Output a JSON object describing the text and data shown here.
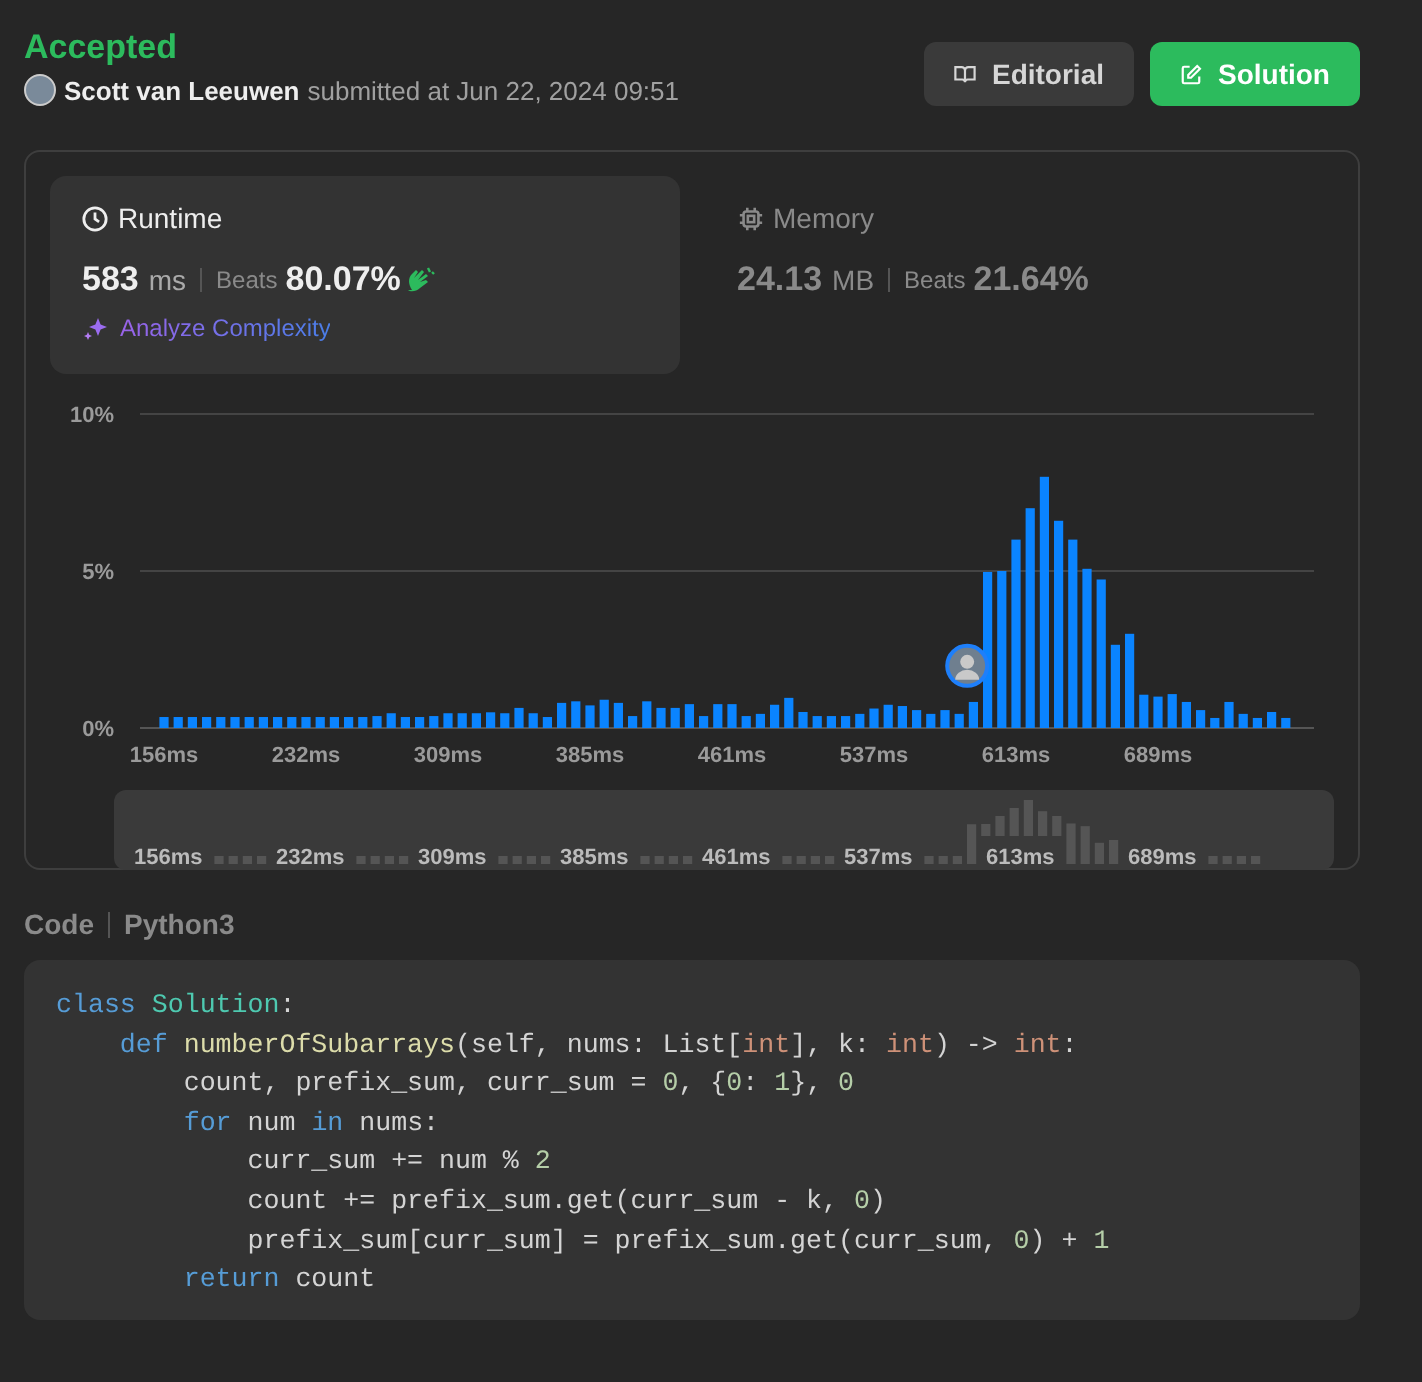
{
  "status": {
    "verdict": "Accepted",
    "author": "Scott van Leeuwen",
    "submitted": "submitted at Jun 22, 2024 09:51"
  },
  "buttons": [
    {
      "label": "Editorial",
      "kind": "secondary"
    },
    {
      "label": "Solution",
      "kind": "primary"
    }
  ],
  "stats": [
    {
      "kind": "runtime",
      "title": "Runtime",
      "value": "583",
      "unit": "ms",
      "beats_label": "Beats",
      "beats": "80.07%",
      "selected": true,
      "action": "Analyze Complexity"
    },
    {
      "kind": "memory",
      "title": "Memory",
      "value": "24.13",
      "unit": "MB",
      "beats_label": "Beats",
      "beats": "21.64%",
      "selected": false
    }
  ],
  "chart": {
    "chart_data": {
      "type": "bar",
      "ylim": [
        0,
        10
      ],
      "yticks": [
        {
          "value": 0,
          "label": "0%"
        },
        {
          "value": 5,
          "label": "5%"
        },
        {
          "value": 10,
          "label": "10%"
        }
      ],
      "categories": [
        "156ms",
        null,
        null,
        null,
        null,
        null,
        null,
        null,
        null,
        null,
        "232ms",
        null,
        null,
        null,
        null,
        null,
        null,
        null,
        null,
        null,
        "309ms",
        null,
        null,
        null,
        null,
        null,
        null,
        null,
        null,
        null,
        "385ms",
        null,
        null,
        null,
        null,
        null,
        null,
        null,
        null,
        null,
        "461ms",
        null,
        null,
        null,
        null,
        null,
        null,
        null,
        null,
        null,
        "537ms",
        null,
        null,
        null,
        null,
        null,
        null,
        null,
        null,
        null,
        "613ms",
        null,
        null,
        null,
        null,
        null,
        null,
        null,
        null,
        null,
        "689ms",
        null,
        null,
        null,
        null,
        null,
        null,
        null,
        null,
        null
      ],
      "values": [
        0.35,
        0.35,
        0.35,
        0.35,
        0.35,
        0.35,
        0.35,
        0.35,
        0.35,
        0.35,
        0.35,
        0.35,
        0.35,
        0.35,
        0.35,
        0.38,
        0.47,
        0.35,
        0.35,
        0.38,
        0.47,
        0.47,
        0.47,
        0.5,
        0.47,
        0.64,
        0.47,
        0.35,
        0.8,
        0.85,
        0.72,
        0.9,
        0.8,
        0.38,
        0.85,
        0.64,
        0.64,
        0.76,
        0.38,
        0.76,
        0.76,
        0.38,
        0.45,
        0.74,
        0.96,
        0.51,
        0.38,
        0.38,
        0.38,
        0.45,
        0.62,
        0.74,
        0.7,
        0.57,
        0.45,
        0.57,
        0.45,
        0.83,
        4.97,
        5.0,
        6.0,
        7.0,
        8.0,
        6.6,
        6.0,
        5.07,
        4.73,
        2.65,
        3.0,
        1.06,
        1.0,
        1.08,
        0.83,
        0.57,
        0.32,
        0.83,
        0.45,
        0.32,
        0.51,
        0.32
      ]
    }
  },
  "overview": {
    "labels": [
      "156ms",
      "232ms",
      "309ms",
      "385ms",
      "461ms",
      "537ms",
      "613ms",
      "689ms"
    ]
  },
  "code": {
    "label": "Code",
    "language": "Python3",
    "lines": [
      [
        {
          "text": "class ",
          "kind": "kw"
        },
        {
          "text": "Solution",
          "kind": "cls"
        },
        {
          "text": ":",
          "kind": "p"
        }
      ],
      [
        {
          "text": "    def ",
          "kind": "kw"
        },
        {
          "text": "numberOfSubarrays",
          "kind": "fn"
        },
        {
          "text": "(self, nums: List[",
          "kind": "p"
        },
        {
          "text": "int",
          "kind": "ty"
        },
        {
          "text": "], k: ",
          "kind": "p"
        },
        {
          "text": "int",
          "kind": "ty"
        },
        {
          "text": ") -> ",
          "kind": "p"
        },
        {
          "text": "int",
          "kind": "ty"
        },
        {
          "text": ":",
          "kind": "p"
        }
      ],
      [
        {
          "text": "        count, prefix_sum, curr_sum = ",
          "kind": "p"
        },
        {
          "text": "0",
          "kind": "n"
        },
        {
          "text": ", {",
          "kind": "p"
        },
        {
          "text": "0",
          "kind": "n"
        },
        {
          "text": ": ",
          "kind": "p"
        },
        {
          "text": "1",
          "kind": "n"
        },
        {
          "text": "}, ",
          "kind": "p"
        },
        {
          "text": "0",
          "kind": "n"
        }
      ],
      [
        {
          "text": "        for",
          "kind": "kw"
        },
        {
          "text": " num ",
          "kind": "p"
        },
        {
          "text": "in",
          "kind": "kw"
        },
        {
          "text": " nums:",
          "kind": "p"
        }
      ],
      [
        {
          "text": "            curr_sum += num % ",
          "kind": "p"
        },
        {
          "text": "2",
          "kind": "n"
        }
      ],
      [
        {
          "text": "            count += prefix_sum.get(curr_sum - k, ",
          "kind": "p"
        },
        {
          "text": "0",
          "kind": "n"
        },
        {
          "text": ")",
          "kind": "p"
        }
      ],
      [
        {
          "text": "            prefix_sum[curr_sum] = prefix_sum.get(curr_sum, ",
          "kind": "p"
        },
        {
          "text": "0",
          "kind": "n"
        },
        {
          "text": ") + ",
          "kind": "p"
        },
        {
          "text": "1",
          "kind": "n"
        }
      ],
      [
        {
          "text": "        return",
          "kind": "kw"
        },
        {
          "text": " count",
          "kind": "p"
        }
      ]
    ]
  }
}
